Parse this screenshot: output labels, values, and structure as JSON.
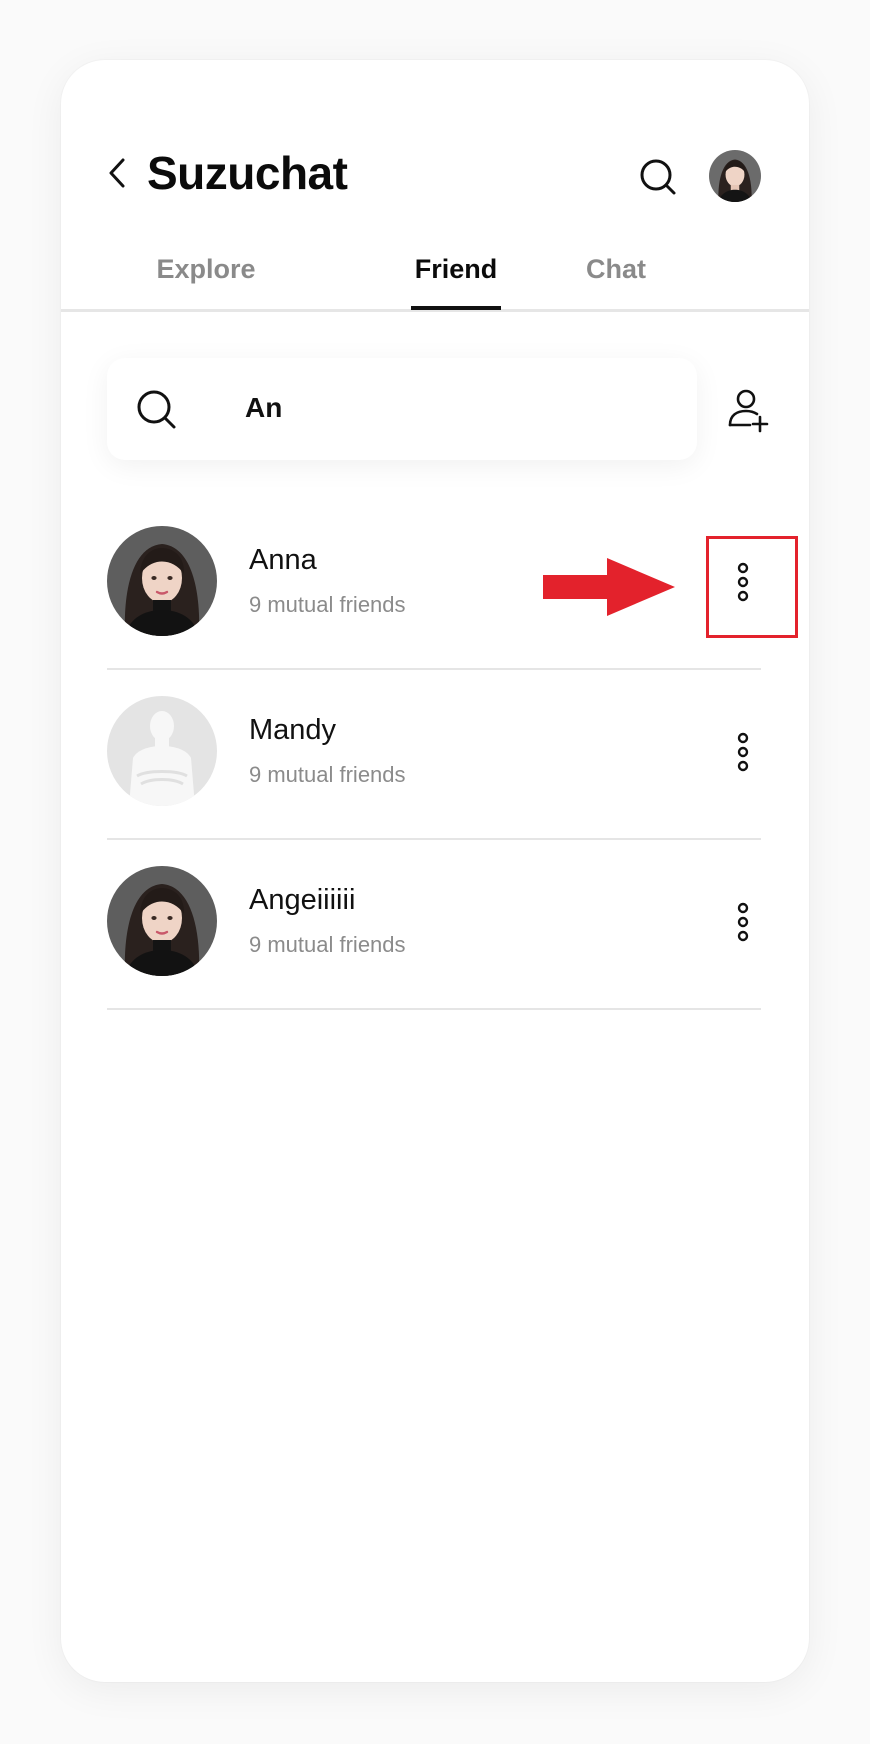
{
  "header": {
    "title": "Suzuchat",
    "back_icon": "chevron-left-icon",
    "search_icon": "search-icon"
  },
  "tabs": [
    {
      "label": "Explore",
      "active": false
    },
    {
      "label": "Friend",
      "active": true
    },
    {
      "label": "Chat",
      "active": false
    }
  ],
  "search": {
    "value": "An",
    "icon": "search-icon"
  },
  "add_friend_icon": "add-user-icon",
  "friends": [
    {
      "name": "Anna",
      "mutual": "9 mutual friends",
      "avatar": "photo"
    },
    {
      "name": "Mandy",
      "mutual": "9 mutual friends",
      "avatar": "placeholder"
    },
    {
      "name": "Angeiiiiii",
      "mutual": "9 mutual friends",
      "avatar": "photo"
    }
  ],
  "annotation": {
    "highlight_color": "#e3222c",
    "target": "more-options on first row"
  },
  "colors": {
    "accent": "#111111",
    "muted_text": "#8b8b8b",
    "divider": "#e5e5e5",
    "annotation_red": "#e3222c"
  }
}
